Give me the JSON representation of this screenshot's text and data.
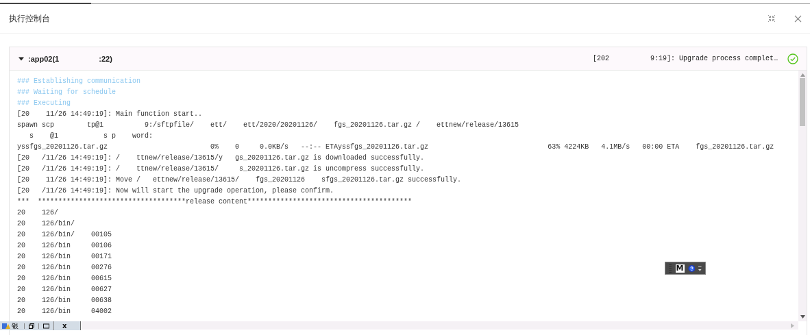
{
  "dialog": {
    "title": "执行控制台"
  },
  "host": {
    "expanded": true,
    "name": ":app02(1",
    "name_end": ":22)",
    "status_text": "[202",
    "status_end": "9:19]: Upgrade process complet…",
    "succeeded": true
  },
  "log_lines": [
    {
      "kind": "info",
      "text": "### Establishing communication"
    },
    {
      "kind": "info",
      "text": "### Waiting for schedule"
    },
    {
      "kind": "info",
      "text": "### Executing"
    },
    {
      "kind": "plain",
      "text": "[20    11/26 14:49:19]: Main function start.."
    },
    {
      "kind": "plain",
      "text": "spawn scp        tp@1          9:/sftpfile/    ett/    ett/2020/20201126/    fgs_20201126.tar.gz /    ettnew/release/13615"
    },
    {
      "kind": "plain",
      "text": "   s    @1           s p    word:"
    },
    {
      "kind": "plain",
      "text": "yssfgs_20201126.tar.gz                         0%    0     0.0KB/s   --:-- ETAyssfgs_20201126.tar.gz                             63% 4224KB   4.1MB/s   00:00 ETA    fgs_20201126.tar.gz"
    },
    {
      "kind": "plain",
      "text": "[20   /11/26 14:49:19]: /    ttnew/release/13615/y   gs_20201126.tar.gz is downloaded successfully."
    },
    {
      "kind": "plain",
      "text": "[20   /11/26 14:49:19]: /    ttnew/release/13615/     s_20201126.tar.gz is uncompress successfully."
    },
    {
      "kind": "plain",
      "text": "[20    11/26 14:49:19]: Move /   ettnew/release/13615/    fgs_20201126    sfgs_20201126.tar.gz successfully."
    },
    {
      "kind": "plain",
      "text": "[20   /11/26 14:49:19]: Now will start the upgrade operation, please confirm."
    },
    {
      "kind": "plain",
      "text": "***  ************************************release content****************************************"
    },
    {
      "kind": "plain",
      "text": "20    126/"
    },
    {
      "kind": "plain",
      "text": "20    126/bin/"
    },
    {
      "kind": "plain",
      "text": "20    126/bin/    00105"
    },
    {
      "kind": "plain",
      "text": "20    126/bin     00106"
    },
    {
      "kind": "plain",
      "text": "20    126/bin     00171"
    },
    {
      "kind": "plain",
      "text": "20    126/bin     00276"
    },
    {
      "kind": "plain",
      "text": "20    126/bin     00615"
    },
    {
      "kind": "plain",
      "text": "20    126/bin     00627"
    },
    {
      "kind": "plain",
      "text": "20    126/bin     00638"
    },
    {
      "kind": "plain",
      "text": "20    126/bin     04002"
    }
  ],
  "minimized_window": {
    "title": "银",
    "close_label": "x"
  },
  "floating_toolbar": {
    "label": "M"
  }
}
